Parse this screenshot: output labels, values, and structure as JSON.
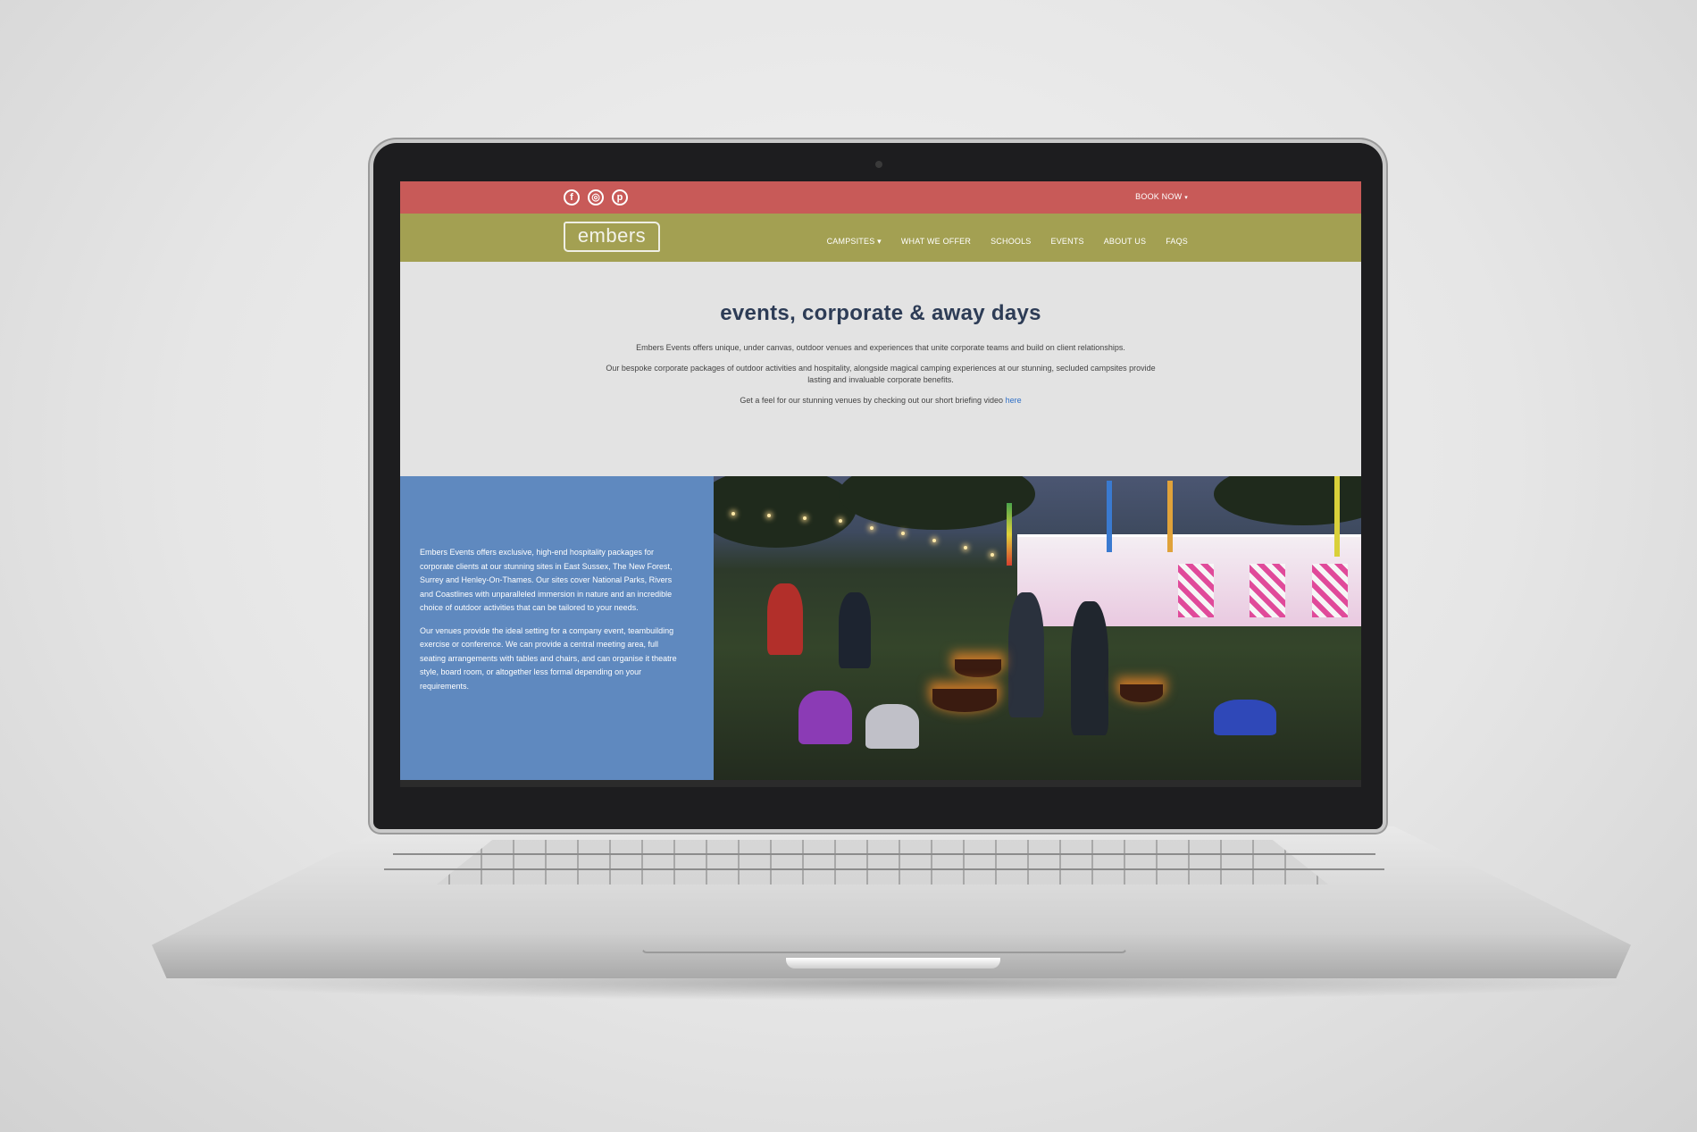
{
  "topbar": {
    "social": [
      {
        "icon": "facebook-icon",
        "glyph": "f"
      },
      {
        "icon": "instagram-icon",
        "glyph": "◎"
      },
      {
        "icon": "pinterest-icon",
        "glyph": "p"
      }
    ],
    "book_now": "BOOK NOW",
    "book_caret": "▾"
  },
  "navbar": {
    "logo": "embers",
    "items": [
      {
        "label": "CAMPSITES",
        "caret": " ▾"
      },
      {
        "label": "WHAT WE OFFER",
        "caret": ""
      },
      {
        "label": "SCHOOLS",
        "caret": ""
      },
      {
        "label": "EVENTS",
        "caret": ""
      },
      {
        "label": "ABOUT US",
        "caret": ""
      },
      {
        "label": "FAQS",
        "caret": ""
      }
    ]
  },
  "intro": {
    "title": "events, corporate & away days",
    "p1": "Embers Events offers unique, under canvas, outdoor venues and experiences that unite corporate teams and build on client relationships.",
    "p2a": "Our bespoke corporate packages of outdoor activities and hospitality, alongside magical camping experiences at our stunning, secluded campsites provide",
    "p2b": "lasting and invaluable corporate benefits.",
    "p3": "Get a feel for our stunning venues by checking out our short briefing video ",
    "p3_link": "here"
  },
  "feature": {
    "p1": "Embers Events offers exclusive, high-end hospitality packages for corporate clients at our stunning sites in East Sussex, The New Forest, Surrey and Henley-On-Thames. Our sites cover National Parks, Rivers and Coastlines with unparalleled immersion in nature and an incredible choice of outdoor activities that can be tailored to your needs.",
    "p2": "Our venues provide the ideal setting for a company event, teambuilding exercise or conference. We can provide a central meeting area, full seating arrangements with tables and chairs, and can organise it theatre style, board room, or altogether less formal depending on your requirements."
  },
  "colors": {
    "topbar": "#c85a58",
    "navbar": "#a3a052",
    "title": "#2d3c56",
    "feature_panel": "#5f89bf",
    "link": "#2e6fc7"
  }
}
